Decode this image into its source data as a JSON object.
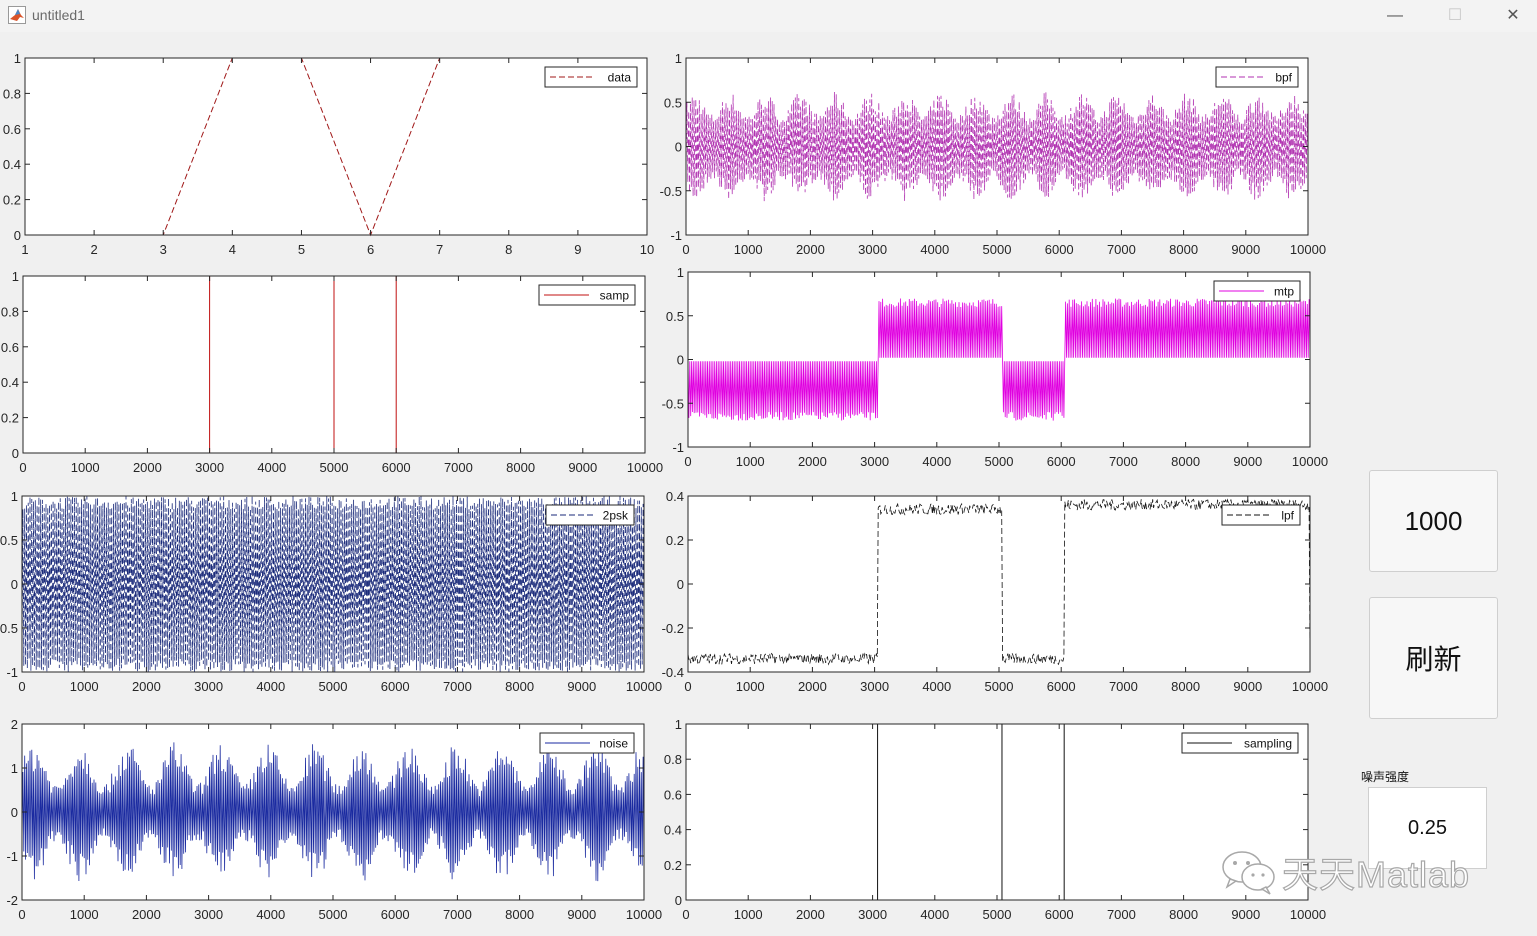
{
  "window": {
    "title": "untitled1",
    "minimize_symbol": "—",
    "maximize_symbol": "☐",
    "close_symbol": "✕"
  },
  "controls": {
    "count_button_label": "1000",
    "refresh_button_label": "刷新",
    "noise_label": "噪声强度",
    "noise_value": "0.25"
  },
  "watermark": {
    "text": "天天Matlab",
    "icon": "wechat-icon"
  },
  "chart_data": [
    {
      "id": "data",
      "type": "line",
      "legend": "data",
      "style": "dashed",
      "color": "#a01818",
      "x": [
        1,
        2,
        3,
        4,
        5,
        6,
        7,
        8,
        9,
        10
      ],
      "y": [
        0,
        0,
        0,
        1,
        1,
        0,
        1,
        1,
        1,
        1
      ],
      "xlim": [
        1,
        10
      ],
      "ylim": [
        0,
        1
      ],
      "xticks": [
        1,
        2,
        3,
        4,
        5,
        6,
        7,
        8,
        9,
        10
      ],
      "yticks": [
        0,
        0.2,
        0.4,
        0.6,
        0.8,
        1
      ],
      "xtick_labels": [
        "1",
        "2",
        "3",
        "4",
        "5",
        "6",
        "7",
        "8",
        "9",
        "10"
      ],
      "ytick_labels": [
        "0",
        "0.2",
        "0.4",
        "0.6",
        "0.8",
        "1"
      ]
    },
    {
      "id": "bpf",
      "type": "line",
      "legend": "bpf",
      "style": "dashed",
      "color": "#b030b0",
      "signal": "bpf",
      "amplitude": 0.62,
      "xlim": [
        0,
        10000
      ],
      "ylim": [
        -1,
        1
      ],
      "xticks": [
        0,
        1000,
        2000,
        3000,
        4000,
        5000,
        6000,
        7000,
        8000,
        9000,
        10000
      ],
      "yticks": [
        -1,
        -0.5,
        0,
        0.5,
        1
      ],
      "xtick_labels": [
        "0",
        "1000",
        "2000",
        "3000",
        "4000",
        "5000",
        "6000",
        "7000",
        "8000",
        "9000",
        "10000"
      ],
      "ytick_labels": [
        "-1",
        "-0.5",
        "0",
        "0.5",
        "1"
      ]
    },
    {
      "id": "samp",
      "type": "line",
      "legend": "samp",
      "style": "solid",
      "color": "#c01010",
      "impulses": [
        3000,
        5000,
        6000
      ],
      "xlim": [
        0,
        10000
      ],
      "ylim": [
        0,
        1
      ],
      "xticks": [
        0,
        1000,
        2000,
        3000,
        4000,
        5000,
        6000,
        7000,
        8000,
        9000,
        10000
      ],
      "yticks": [
        0,
        0.2,
        0.4,
        0.6,
        0.8,
        1
      ],
      "xtick_labels": [
        "0",
        "1000",
        "2000",
        "3000",
        "4000",
        "5000",
        "6000",
        "7000",
        "8000",
        "9000",
        "10000"
      ],
      "ytick_labels": [
        "0",
        "0.2",
        "0.4",
        "0.6",
        "0.8",
        "1"
      ]
    },
    {
      "id": "mtp",
      "type": "line",
      "legend": "mtp",
      "style": "solid",
      "color": "#e000e0",
      "signal": "mtp",
      "segments": [
        [
          0,
          3050,
          -1
        ],
        [
          3050,
          5050,
          1
        ],
        [
          5050,
          6050,
          -1
        ],
        [
          6050,
          10000,
          1
        ]
      ],
      "xlim": [
        0,
        10000
      ],
      "ylim": [
        -1,
        1
      ],
      "xticks": [
        0,
        1000,
        2000,
        3000,
        4000,
        5000,
        6000,
        7000,
        8000,
        9000,
        10000
      ],
      "yticks": [
        -1,
        -0.5,
        0,
        0.5,
        1
      ],
      "xtick_labels": [
        "0",
        "1000",
        "2000",
        "3000",
        "4000",
        "5000",
        "6000",
        "7000",
        "8000",
        "9000",
        "10000"
      ],
      "ytick_labels": [
        "-1",
        "-0.5",
        "0",
        "0.5",
        "1"
      ]
    },
    {
      "id": "2psk",
      "type": "line",
      "legend": "2psk",
      "style": "dashed",
      "color": "#1a2a7a",
      "signal": "psk",
      "xlim": [
        0,
        10000
      ],
      "ylim": [
        -1,
        1
      ],
      "xticks": [
        0,
        1000,
        2000,
        3000,
        4000,
        5000,
        6000,
        7000,
        8000,
        9000,
        10000
      ],
      "yticks": [
        -1,
        -0.5,
        0,
        0.5,
        1
      ],
      "xtick_labels": [
        "0",
        "1000",
        "2000",
        "3000",
        "4000",
        "5000",
        "6000",
        "7000",
        "8000",
        "9000",
        "10000"
      ],
      "ytick_labels": [
        "-1",
        "-0.5",
        "0",
        "0.5",
        "1"
      ]
    },
    {
      "id": "lpf",
      "type": "line",
      "legend": "lpf",
      "style": "dashed",
      "color": "#111111",
      "signal": "lpf",
      "segments": [
        [
          0,
          3050,
          -0.34
        ],
        [
          3050,
          5050,
          0.34
        ],
        [
          5050,
          6050,
          -0.34
        ],
        [
          6050,
          10000,
          0.36
        ]
      ],
      "xlim": [
        0,
        10000
      ],
      "ylim": [
        -0.4,
        0.4
      ],
      "xticks": [
        0,
        1000,
        2000,
        3000,
        4000,
        5000,
        6000,
        7000,
        8000,
        9000,
        10000
      ],
      "yticks": [
        -0.4,
        -0.2,
        0,
        0.2,
        0.4
      ],
      "xtick_labels": [
        "0",
        "1000",
        "2000",
        "3000",
        "4000",
        "5000",
        "6000",
        "7000",
        "8000",
        "9000",
        "10000"
      ],
      "ytick_labels": [
        "-0.4",
        "-0.2",
        "0",
        "0.2",
        "0.4"
      ]
    },
    {
      "id": "noise",
      "type": "line",
      "legend": "noise",
      "style": "solid",
      "color": "#1a2aa0",
      "signal": "noise",
      "xlim": [
        0,
        10000
      ],
      "ylim": [
        -2,
        2
      ],
      "xticks": [
        0,
        1000,
        2000,
        3000,
        4000,
        5000,
        6000,
        7000,
        8000,
        9000,
        10000
      ],
      "yticks": [
        -2,
        -1,
        0,
        1,
        2
      ],
      "xtick_labels": [
        "0",
        "1000",
        "2000",
        "3000",
        "4000",
        "5000",
        "6000",
        "7000",
        "8000",
        "9000",
        "10000"
      ],
      "ytick_labels": [
        "-2",
        "-1",
        "0",
        "1",
        "2"
      ]
    },
    {
      "id": "sampling",
      "type": "line",
      "legend": "sampling",
      "style": "solid",
      "color": "#111111",
      "impulses": [
        0,
        3080,
        5080,
        6080
      ],
      "xlim": [
        0,
        10000
      ],
      "ylim": [
        0,
        1
      ],
      "xticks": [
        0,
        1000,
        2000,
        3000,
        4000,
        5000,
        6000,
        7000,
        8000,
        9000,
        10000
      ],
      "yticks": [
        0,
        0.2,
        0.4,
        0.6,
        0.8,
        1
      ],
      "xtick_labels": [
        "0",
        "1000",
        "2000",
        "3000",
        "4000",
        "5000",
        "6000",
        "7000",
        "8000",
        "9000",
        "10000"
      ],
      "ytick_labels": [
        "0",
        "0.2",
        "0.4",
        "0.6",
        "0.8",
        "1"
      ]
    }
  ]
}
